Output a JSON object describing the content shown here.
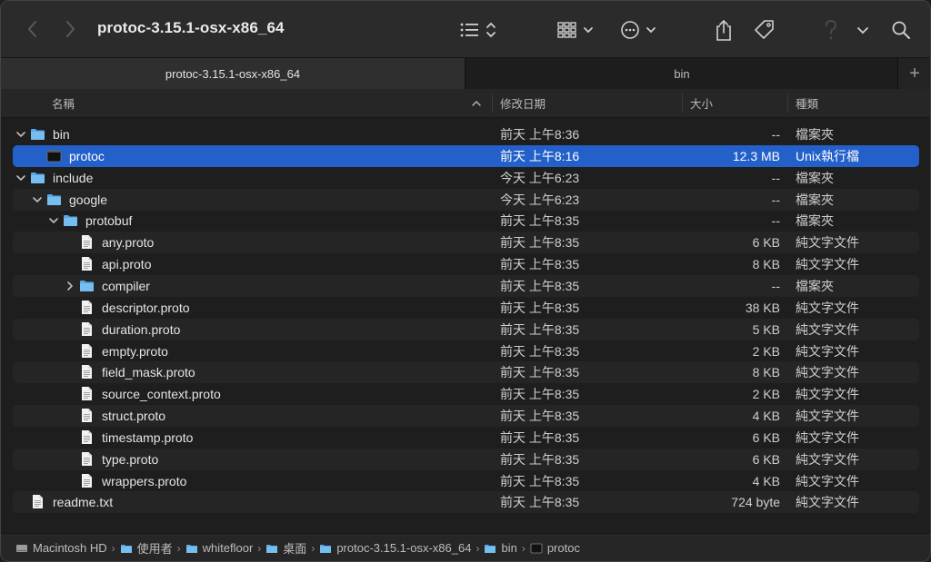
{
  "window": {
    "title": "protoc-3.15.1-osx-x86_64"
  },
  "toolbar": {
    "icons": [
      "chevron-back-icon",
      "chevron-forward-icon",
      "list-view-icon",
      "group-icon",
      "more-actions-icon",
      "share-icon",
      "tag-icon",
      "help-icon",
      "dropdown-icon",
      "search-icon"
    ]
  },
  "tabs": [
    {
      "label": "protoc-3.15.1-osx-x86_64",
      "active": true
    },
    {
      "label": "bin",
      "active": false
    }
  ],
  "columns": {
    "name": "名稱",
    "date": "修改日期",
    "size": "大小",
    "kind": "種類"
  },
  "rows": [
    {
      "name": "bin",
      "date": "前天 上午8:36",
      "size": "--",
      "kind": "檔案夾",
      "type": "folder",
      "indent": 0,
      "disclosure": "open"
    },
    {
      "name": "protoc",
      "date": "前天 上午8:16",
      "size": "12.3 MB",
      "kind": "Unix執行檔",
      "type": "exec",
      "indent": 1,
      "disclosure": "none",
      "selected": true
    },
    {
      "name": "include",
      "date": "今天 上午6:23",
      "size": "--",
      "kind": "檔案夾",
      "type": "folder",
      "indent": 0,
      "disclosure": "open"
    },
    {
      "name": "google",
      "date": "今天 上午6:23",
      "size": "--",
      "kind": "檔案夾",
      "type": "folder",
      "indent": 1,
      "disclosure": "open"
    },
    {
      "name": "protobuf",
      "date": "前天 上午8:35",
      "size": "--",
      "kind": "檔案夾",
      "type": "folder",
      "indent": 2,
      "disclosure": "open"
    },
    {
      "name": "any.proto",
      "date": "前天 上午8:35",
      "size": "6 KB",
      "kind": "純文字文件",
      "type": "doc",
      "indent": 3,
      "disclosure": "none"
    },
    {
      "name": "api.proto",
      "date": "前天 上午8:35",
      "size": "8 KB",
      "kind": "純文字文件",
      "type": "doc",
      "indent": 3,
      "disclosure": "none"
    },
    {
      "name": "compiler",
      "date": "前天 上午8:35",
      "size": "--",
      "kind": "檔案夾",
      "type": "folder",
      "indent": 3,
      "disclosure": "closed"
    },
    {
      "name": "descriptor.proto",
      "date": "前天 上午8:35",
      "size": "38 KB",
      "kind": "純文字文件",
      "type": "doc",
      "indent": 3,
      "disclosure": "none"
    },
    {
      "name": "duration.proto",
      "date": "前天 上午8:35",
      "size": "5 KB",
      "kind": "純文字文件",
      "type": "doc",
      "indent": 3,
      "disclosure": "none"
    },
    {
      "name": "empty.proto",
      "date": "前天 上午8:35",
      "size": "2 KB",
      "kind": "純文字文件",
      "type": "doc",
      "indent": 3,
      "disclosure": "none"
    },
    {
      "name": "field_mask.proto",
      "date": "前天 上午8:35",
      "size": "8 KB",
      "kind": "純文字文件",
      "type": "doc",
      "indent": 3,
      "disclosure": "none"
    },
    {
      "name": "source_context.proto",
      "date": "前天 上午8:35",
      "size": "2 KB",
      "kind": "純文字文件",
      "type": "doc",
      "indent": 3,
      "disclosure": "none"
    },
    {
      "name": "struct.proto",
      "date": "前天 上午8:35",
      "size": "4 KB",
      "kind": "純文字文件",
      "type": "doc",
      "indent": 3,
      "disclosure": "none"
    },
    {
      "name": "timestamp.proto",
      "date": "前天 上午8:35",
      "size": "6 KB",
      "kind": "純文字文件",
      "type": "doc",
      "indent": 3,
      "disclosure": "none"
    },
    {
      "name": "type.proto",
      "date": "前天 上午8:35",
      "size": "6 KB",
      "kind": "純文字文件",
      "type": "doc",
      "indent": 3,
      "disclosure": "none"
    },
    {
      "name": "wrappers.proto",
      "date": "前天 上午8:35",
      "size": "4 KB",
      "kind": "純文字文件",
      "type": "doc",
      "indent": 3,
      "disclosure": "none"
    },
    {
      "name": "readme.txt",
      "date": "前天 上午8:35",
      "size": "724 byte",
      "kind": "純文字文件",
      "type": "doc",
      "indent": 0,
      "disclosure": "none"
    }
  ],
  "pathbar": [
    {
      "label": "Macintosh HD",
      "icon": "drive-icon"
    },
    {
      "label": "使用者",
      "icon": "folder-icon"
    },
    {
      "label": "whitefloor",
      "icon": "home-folder-icon"
    },
    {
      "label": "桌面",
      "icon": "folder-icon"
    },
    {
      "label": "protoc-3.15.1-osx-x86_64",
      "icon": "folder-icon"
    },
    {
      "label": "bin",
      "icon": "folder-icon"
    },
    {
      "label": "protoc",
      "icon": "exec-icon"
    }
  ],
  "colors": {
    "selection": "#2360c9",
    "folder": "#5aa9e6",
    "background": "#1e1e1e"
  }
}
